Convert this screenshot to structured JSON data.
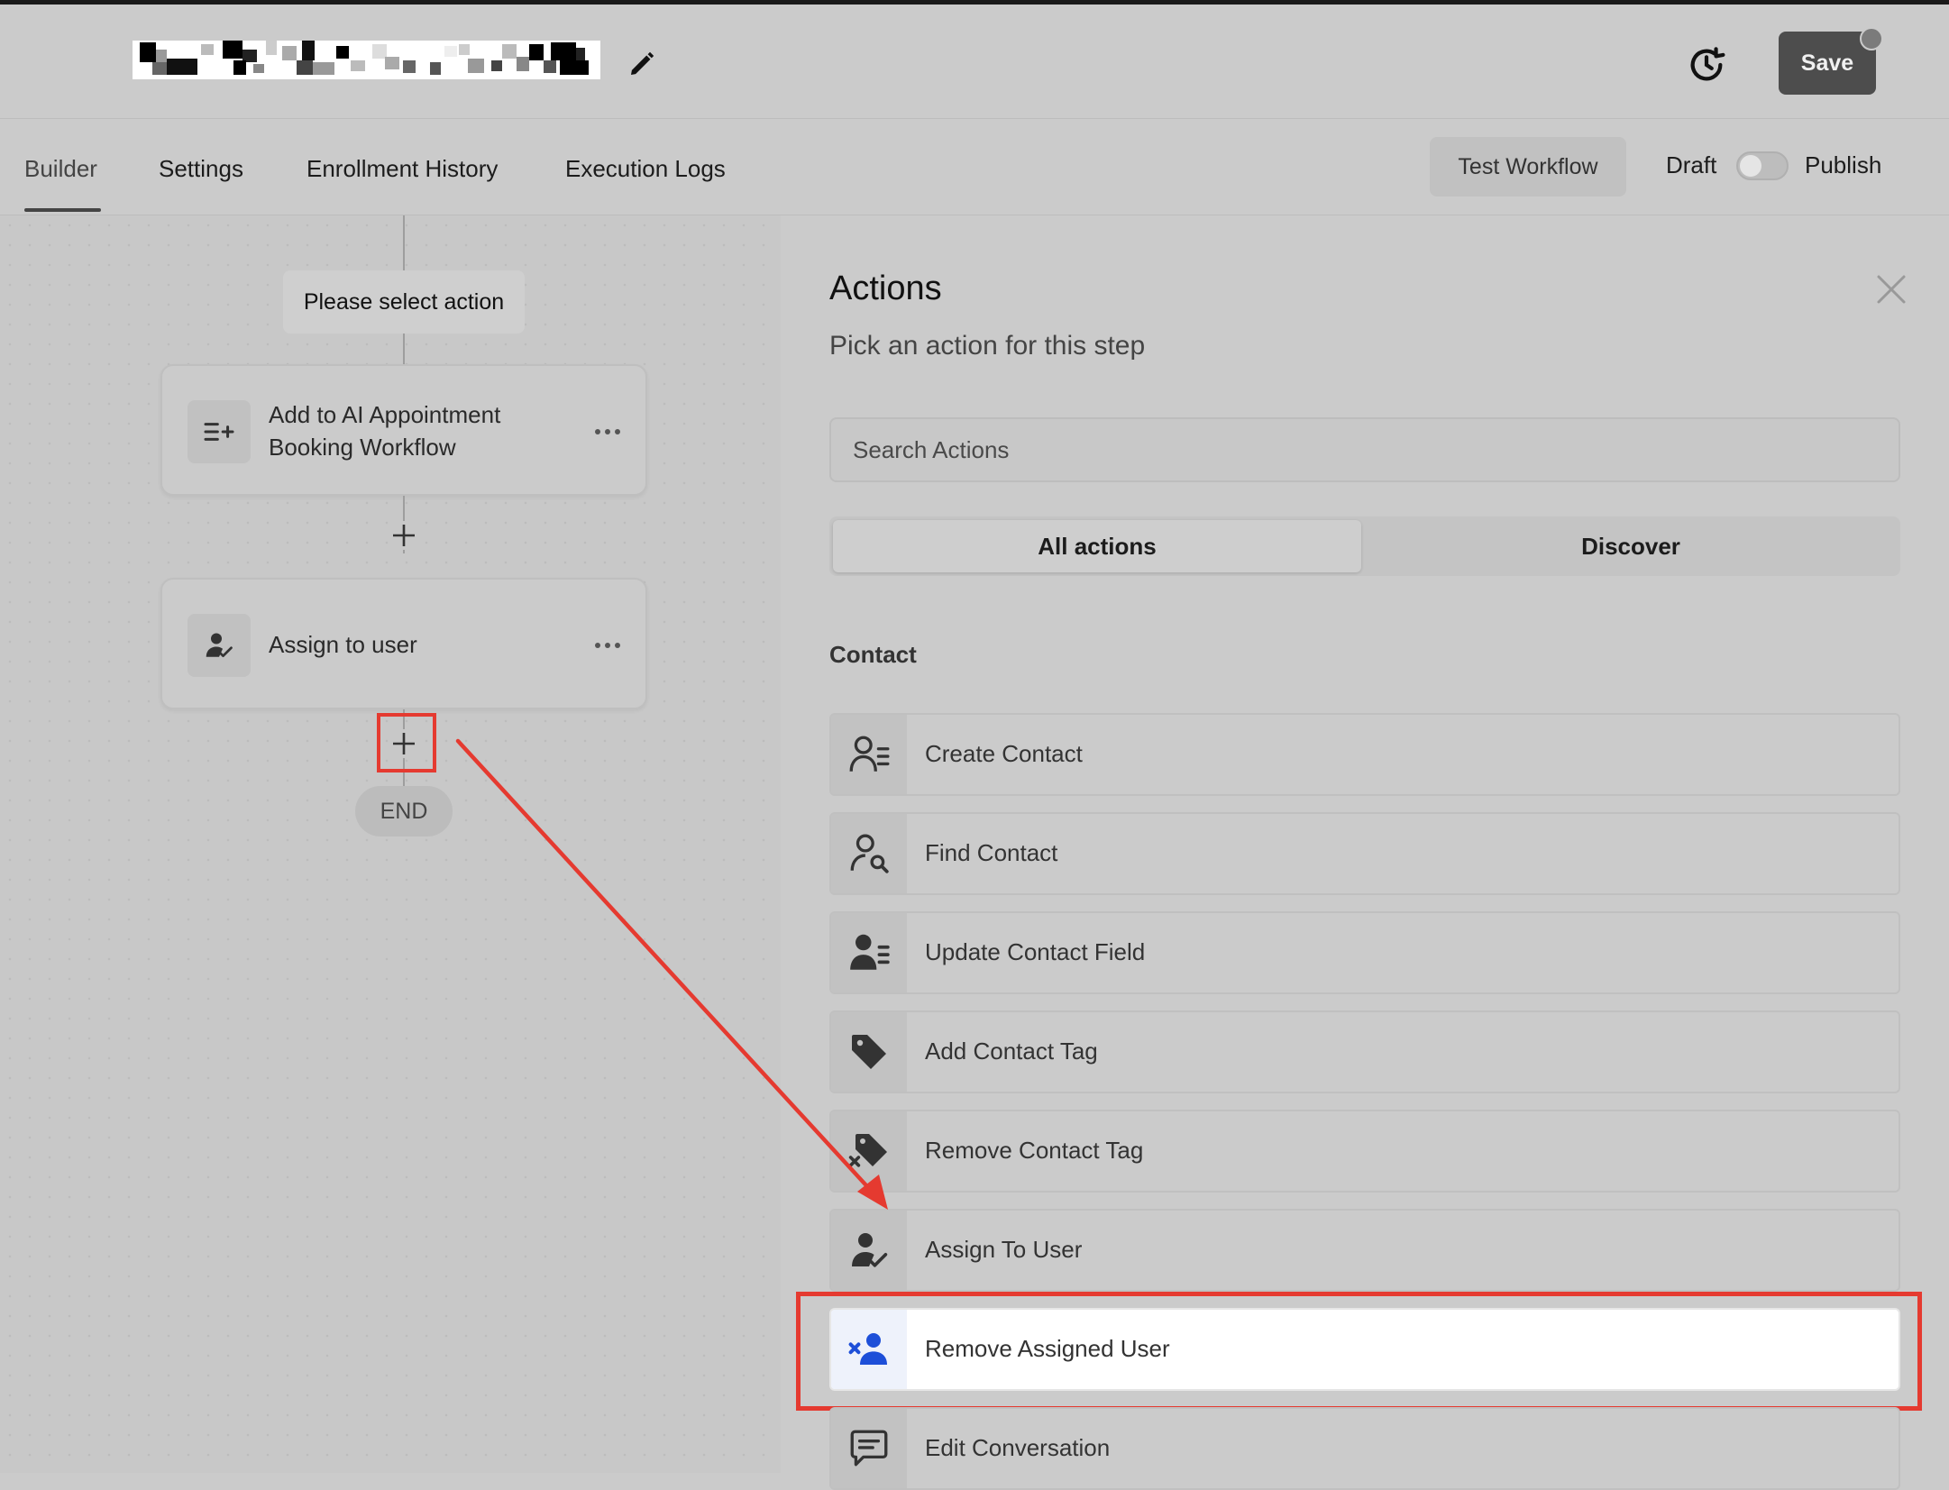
{
  "header": {
    "save_label": "Save",
    "edit_icon": "pencil-icon",
    "history_icon": "history-icon"
  },
  "tabs": {
    "builder": "Builder",
    "settings": "Settings",
    "enrollment_history": "Enrollment History",
    "execution_logs": "Execution Logs",
    "active": "Builder"
  },
  "toolbar": {
    "test_workflow": "Test Workflow",
    "draft": "Draft",
    "publish": "Publish"
  },
  "canvas": {
    "placeholder_step": "Please select action",
    "steps": [
      {
        "label_line1": "Add to AI Appointment",
        "label_line2": "Booking Workflow",
        "icon": "list-add-icon"
      },
      {
        "label": "Assign to user",
        "icon": "user-check-icon"
      }
    ],
    "end_label": "END"
  },
  "panel": {
    "title": "Actions",
    "subtitle": "Pick an action for this step",
    "search_placeholder": "Search Actions",
    "segments": {
      "all": "All actions",
      "discover": "Discover",
      "active": "All actions"
    },
    "section": "Contact",
    "actions": [
      {
        "label": "Create Contact",
        "icon": "create-contact-icon"
      },
      {
        "label": "Find Contact",
        "icon": "find-contact-icon"
      },
      {
        "label": "Update Contact Field",
        "icon": "update-contact-icon"
      },
      {
        "label": "Add Contact Tag",
        "icon": "tag-icon"
      },
      {
        "label": "Remove Contact Tag",
        "icon": "tag-remove-icon"
      },
      {
        "label": "Assign To User",
        "icon": "user-check-icon"
      },
      {
        "label": "Remove Assigned User",
        "icon": "user-remove-icon",
        "highlighted": true
      },
      {
        "label": "Edit Conversation",
        "icon": "chat-icon"
      }
    ]
  },
  "colors": {
    "accent_blue": "#1d4fd8",
    "annotation_red": "#e53a30",
    "save_button": "#4d4d4d"
  }
}
